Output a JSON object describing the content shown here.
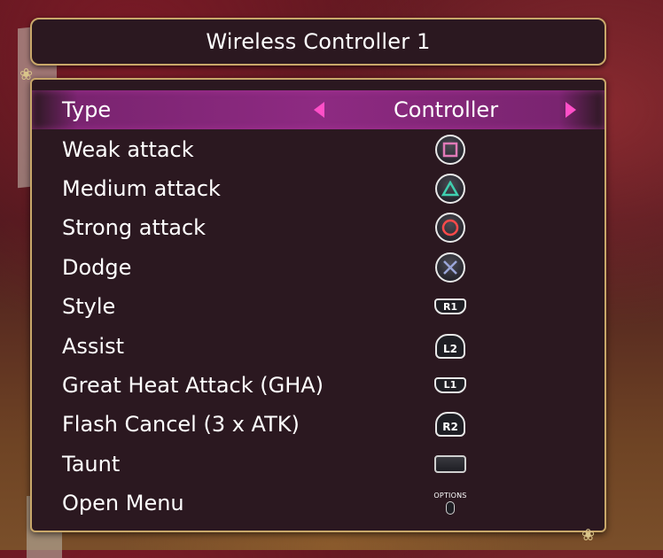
{
  "header": {
    "title": "Wireless Controller 1"
  },
  "type_row": {
    "label": "Type",
    "value": "Controller"
  },
  "bindings": [
    {
      "label": "Weak attack",
      "button": "square-button-icon"
    },
    {
      "label": "Medium attack",
      "button": "triangle-button-icon"
    },
    {
      "label": "Strong attack",
      "button": "circle-button-icon"
    },
    {
      "label": "Dodge",
      "button": "cross-button-icon"
    },
    {
      "label": "Style",
      "button": "r1-button-icon",
      "glyph": "R1"
    },
    {
      "label": "Assist",
      "button": "l2-button-icon",
      "glyph": "L2"
    },
    {
      "label": "Great Heat Attack (GHA)",
      "button": "l1-button-icon",
      "glyph": "L1"
    },
    {
      "label": "Flash Cancel (3 x ATK)",
      "button": "r2-button-icon",
      "glyph": "R2"
    },
    {
      "label": "Taunt",
      "button": "touchpad-button-icon"
    },
    {
      "label": "Open Menu",
      "button": "options-button-icon",
      "glyph": "OPTIONS"
    }
  ],
  "colors": {
    "accent_arrow": "#ff4fc8",
    "selected_row": "#8e2a82",
    "panel_border": "#c9a86a",
    "square": "#e07ab8",
    "triangle": "#3fd0b0",
    "circle": "#ff4a4a",
    "cross": "#9aa6d8"
  }
}
